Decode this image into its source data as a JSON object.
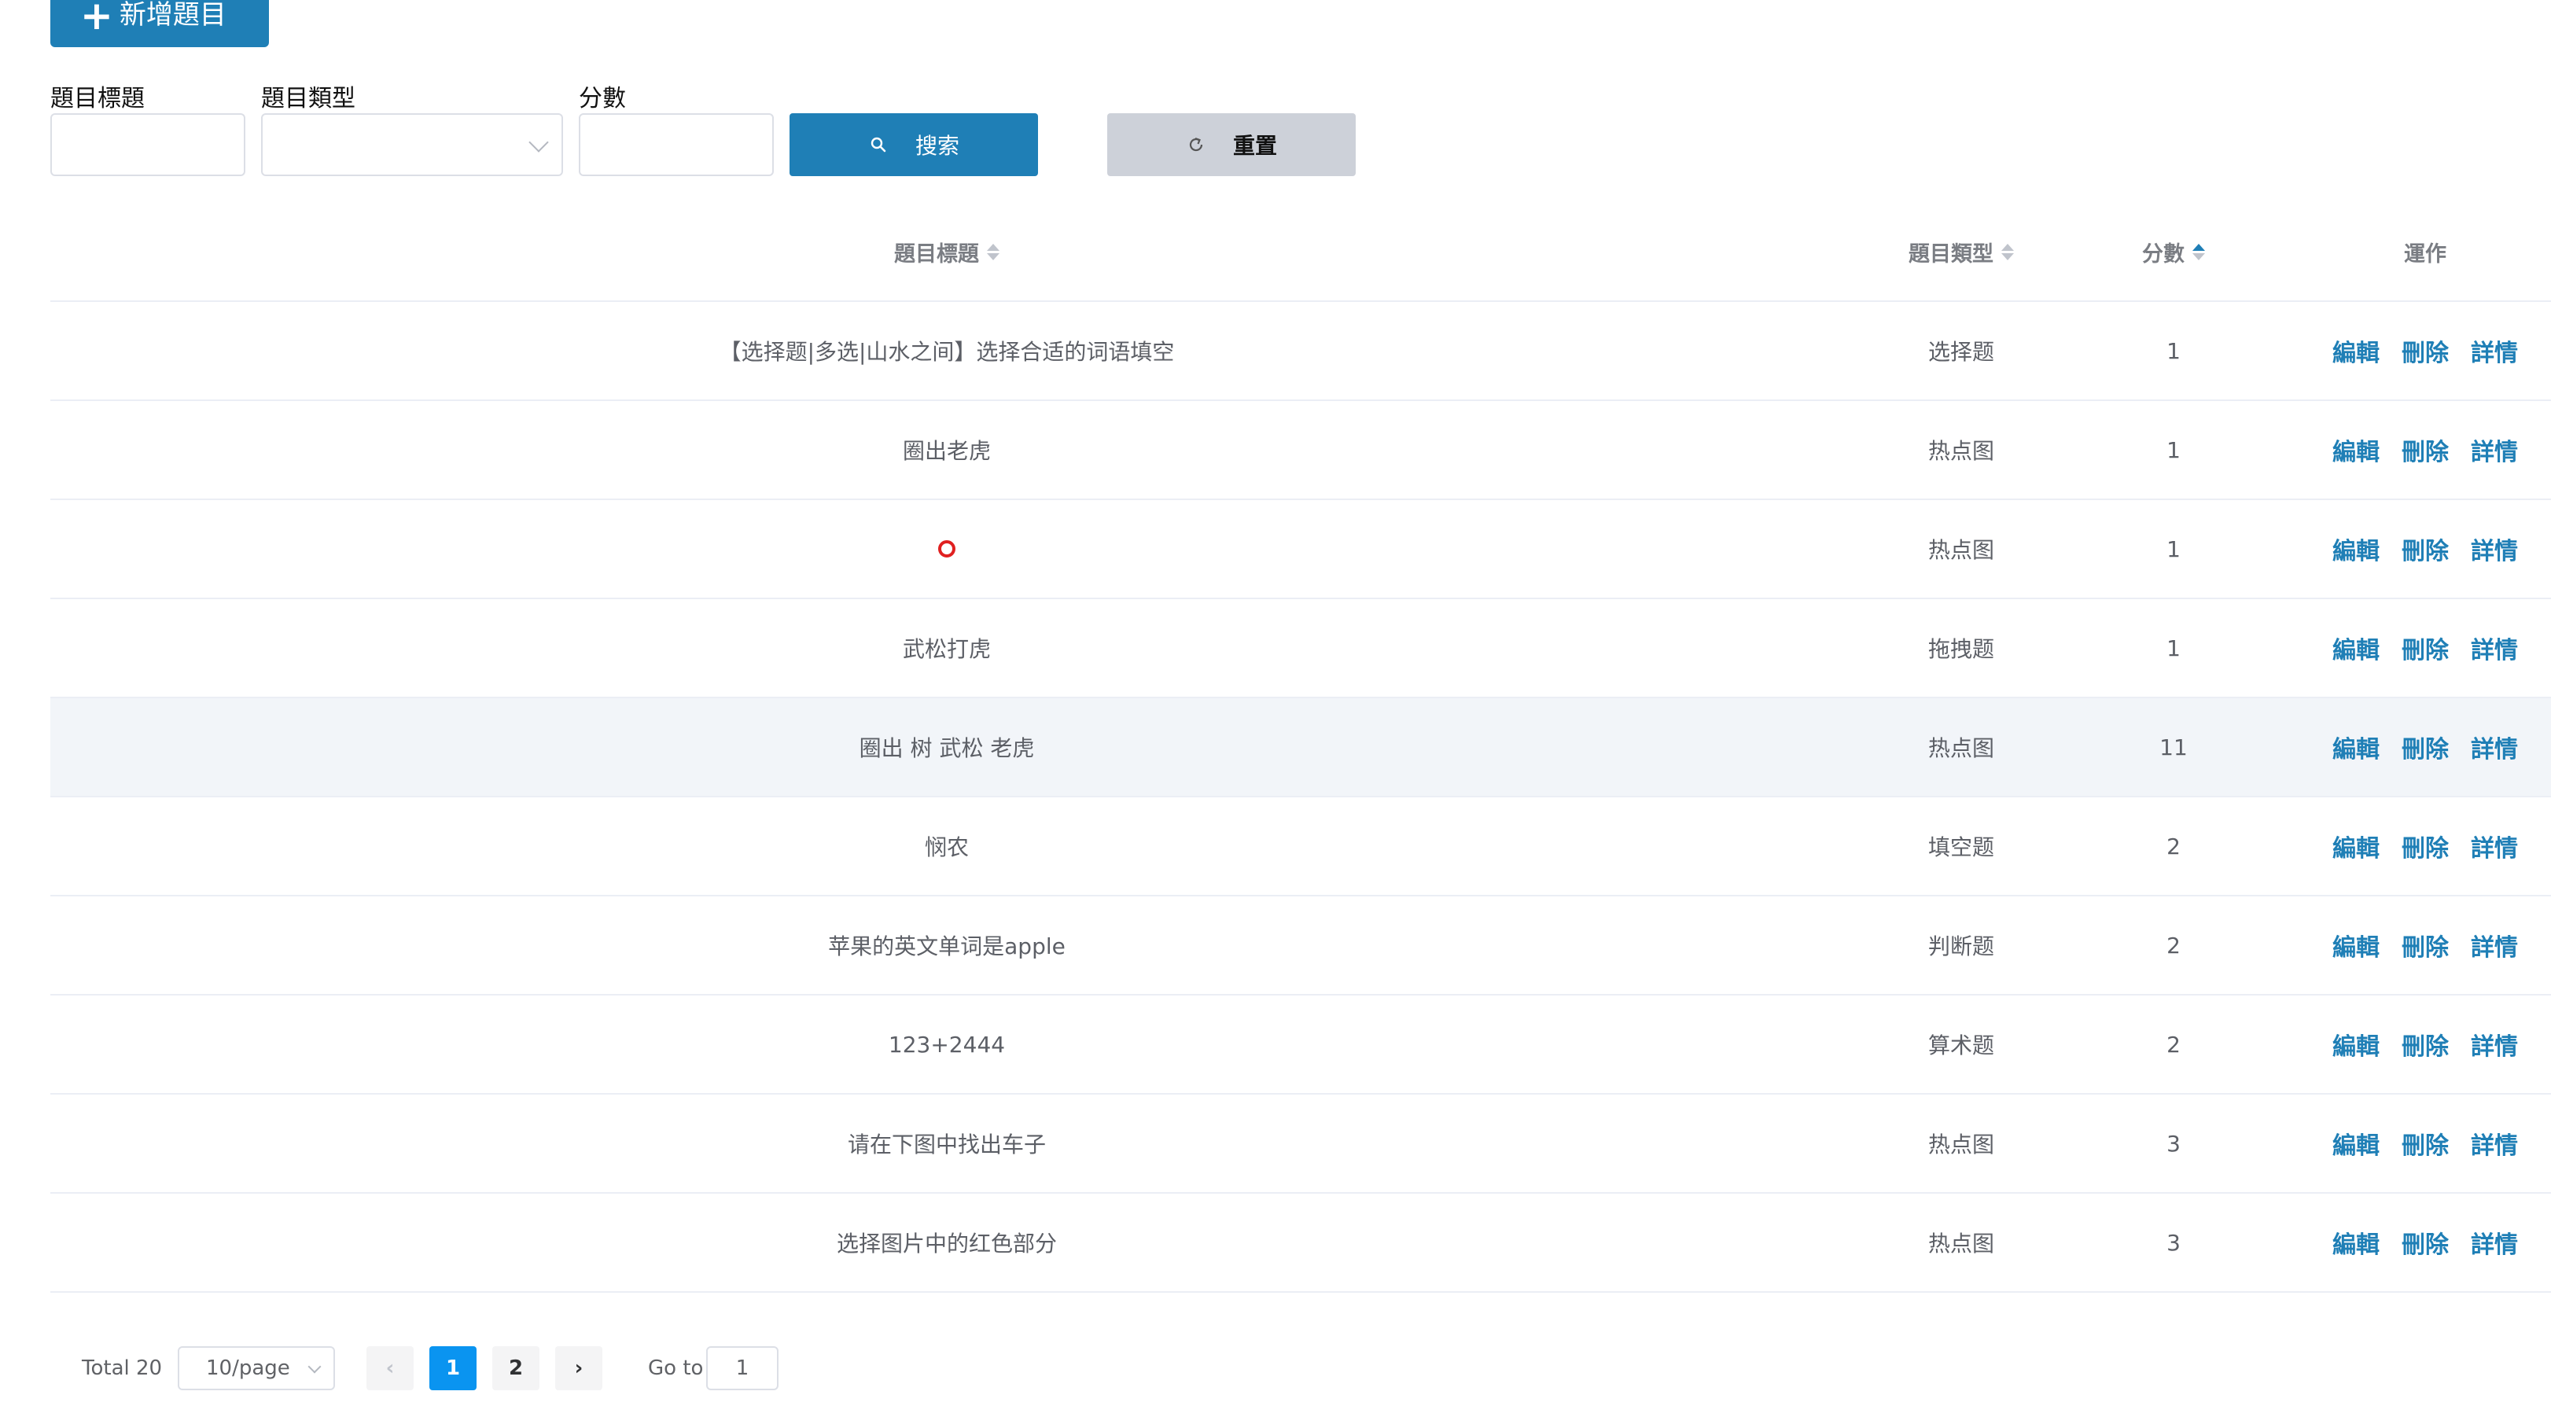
{
  "toolbar": {
    "add_label": "新增題目"
  },
  "filters": {
    "title_label": "題目標題",
    "title_value": "",
    "type_label": "題目類型",
    "type_value": "",
    "score_label": "分數",
    "score_value": "",
    "search_label": "搜索",
    "reset_label": "重置"
  },
  "table": {
    "columns": {
      "title": "題目標題",
      "type": "題目類型",
      "score": "分數",
      "actions": "運作"
    },
    "rows": [
      {
        "title": "【选择题|多选|山水之间】选择合适的词语填空",
        "type": "选择题",
        "score": "1"
      },
      {
        "title": "圈出老虎",
        "type": "热点图",
        "score": "1"
      },
      {
        "title": "",
        "type": "热点图",
        "score": "1",
        "title_icon": "red-circle-icon"
      },
      {
        "title": "武松打虎",
        "type": "拖拽题",
        "score": "1"
      },
      {
        "title": "圈出 树 武松 老虎",
        "type": "热点图",
        "score": "11"
      },
      {
        "title": "悯农",
        "type": "填空题",
        "score": "2"
      },
      {
        "title": "苹果的英文单词是apple",
        "type": "判断题",
        "score": "2"
      },
      {
        "title": "123+2444",
        "type": "算术题",
        "score": "2"
      },
      {
        "title": "请在下图中找出车子",
        "type": "热点图",
        "score": "3"
      },
      {
        "title": "选择图片中的红色部分",
        "type": "热点图",
        "score": "3"
      }
    ],
    "action_labels": {
      "edit": "編輯",
      "delete": "刪除",
      "detail": "詳情"
    }
  },
  "pagination": {
    "total": "Total 20",
    "page_size": "10/page",
    "pages": [
      "1",
      "2"
    ],
    "current_page": "1",
    "goto_label": "Go to",
    "goto_value": "1"
  },
  "colors": {
    "primary": "#1f7fb6",
    "page_active": "#0a94f0",
    "reset_bg": "#cdd1d9",
    "row_hover": "#f2f5f9",
    "red_mark": "#e02020"
  }
}
